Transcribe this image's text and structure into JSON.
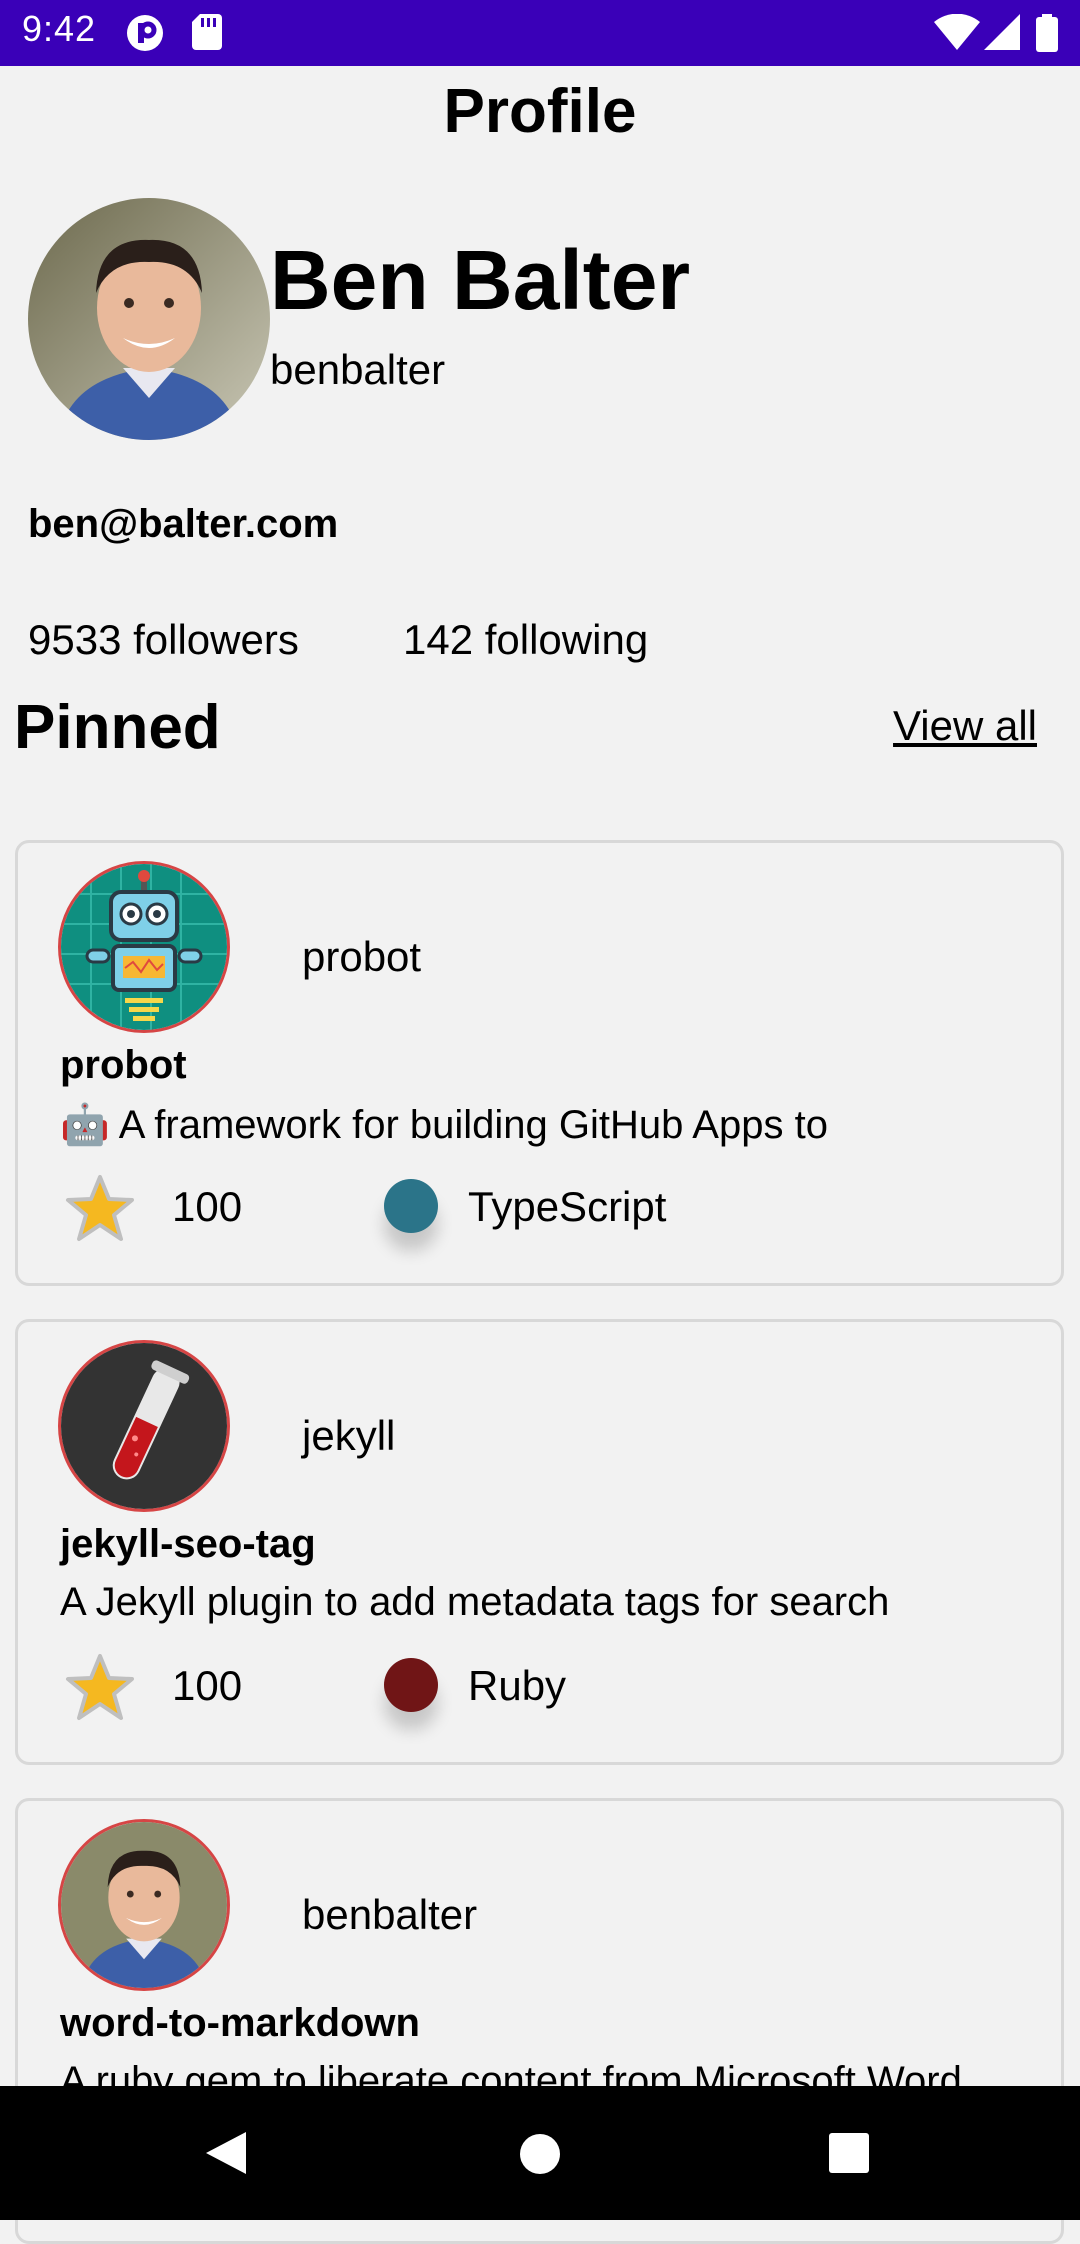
{
  "status_bar": {
    "time": "9:42",
    "icons": [
      "app-notification-icon",
      "sd-card-icon",
      "wifi-icon",
      "signal-icon",
      "battery-icon"
    ]
  },
  "header": {
    "title": "Profile"
  },
  "profile": {
    "name": "Ben Balter",
    "login": "benbalter",
    "email": "ben@balter.com",
    "followers": "9533 followers",
    "following": "142 following"
  },
  "pinned": {
    "title": "Pinned",
    "view_all": "View all",
    "items": [
      {
        "owner": "probot",
        "name": "probot",
        "description": "🤖 A framework for building GitHub Apps to",
        "stars": "100",
        "language": "TypeScript",
        "language_color": "#2b7489"
      },
      {
        "owner": "jekyll",
        "name": "jekyll-seo-tag",
        "description": "A Jekyll plugin to add metadata tags for search",
        "stars": "100",
        "language": "Ruby",
        "language_color": "#701516"
      },
      {
        "owner": "benbalter",
        "name": "word-to-markdown",
        "description": "A ruby gem to liberate content from Microsoft Word"
      }
    ]
  },
  "nav_bar": {
    "buttons": [
      "back-icon",
      "home-icon",
      "recents-icon"
    ]
  }
}
